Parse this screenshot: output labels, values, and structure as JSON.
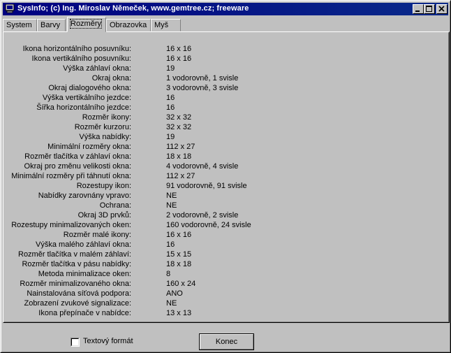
{
  "window": {
    "title": "SysInfo;   (c) Ing. Miroslav Němeček, www.gemtree.cz;   freeware",
    "controls": [
      "minimize-icon",
      "maximize-icon",
      "close-icon"
    ]
  },
  "tabs": [
    {
      "label": "System",
      "active": false
    },
    {
      "label": "Barvy",
      "active": false
    },
    {
      "label": "Rozměry",
      "active": true
    },
    {
      "label": "Obrazovka",
      "active": false
    },
    {
      "label": "Myš",
      "active": false
    }
  ],
  "rows": [
    {
      "label": "Ikona horizontálního posuvníku:",
      "value": "16 x 16"
    },
    {
      "label": "Ikona vertikálního posuvníku:",
      "value": "16 x 16"
    },
    {
      "label": "Výška záhlaví okna:",
      "value": "19"
    },
    {
      "label": "Okraj okna:",
      "value": "1 vodorovně, 1 svisle"
    },
    {
      "label": "Okraj dialogového okna:",
      "value": "3 vodorovně, 3 svisle"
    },
    {
      "label": "Výška vertikálního jezdce:",
      "value": "16"
    },
    {
      "label": "Šířka horizontálního jezdce:",
      "value": "16"
    },
    {
      "label": "Rozměr ikony:",
      "value": "32 x 32"
    },
    {
      "label": "Rozměr kurzoru:",
      "value": "32 x 32"
    },
    {
      "label": "Výška nabídky:",
      "value": "19"
    },
    {
      "label": "Minimální rozměry okna:",
      "value": "112 x 27"
    },
    {
      "label": "Rozměr tlačítka v záhlaví okna:",
      "value": "18 x 18"
    },
    {
      "label": "Okraj pro změnu velikosti okna:",
      "value": "4 vodorovně, 4 svisle"
    },
    {
      "label": "Minimální rozměry při táhnutí okna:",
      "value": "112 x 27"
    },
    {
      "label": "Rozestupy ikon:",
      "value": "91 vodorovně, 91 svisle"
    },
    {
      "label": "Nabídky zarovnány vpravo:",
      "value": "NE"
    },
    {
      "label": "Ochrana:",
      "value": "NE"
    },
    {
      "label": "Okraj 3D prvků:",
      "value": "2 vodorovně, 2 svisle"
    },
    {
      "label": "Rozestupy minimalizovaných oken:",
      "value": "160 vodorovně, 24 svisle"
    },
    {
      "label": "Rozměr malé ikony:",
      "value": "16 x 16"
    },
    {
      "label": "Výška malého záhlaví okna:",
      "value": "16"
    },
    {
      "label": "Rozměr tlačítka v malém záhlaví:",
      "value": "15 x 15"
    },
    {
      "label": "Rozměr tlačítka v pásu nabídky:",
      "value": "18 x 18"
    },
    {
      "label": "Metoda minimalizace oken:",
      "value": "8"
    },
    {
      "label": "Rozměr minimalizovaného okna:",
      "value": "160 x 24"
    },
    {
      "label": "Nainstalována síťová podpora:",
      "value": "ANO"
    },
    {
      "label": "Zobrazení zvukové signalizace:",
      "value": "NE"
    },
    {
      "label": "Ikona přepínače v nabídce:",
      "value": "13 x 13"
    }
  ],
  "bottom": {
    "checkbox_label": "Textový formát",
    "checkbox_checked": false,
    "close_button": "Konec"
  }
}
